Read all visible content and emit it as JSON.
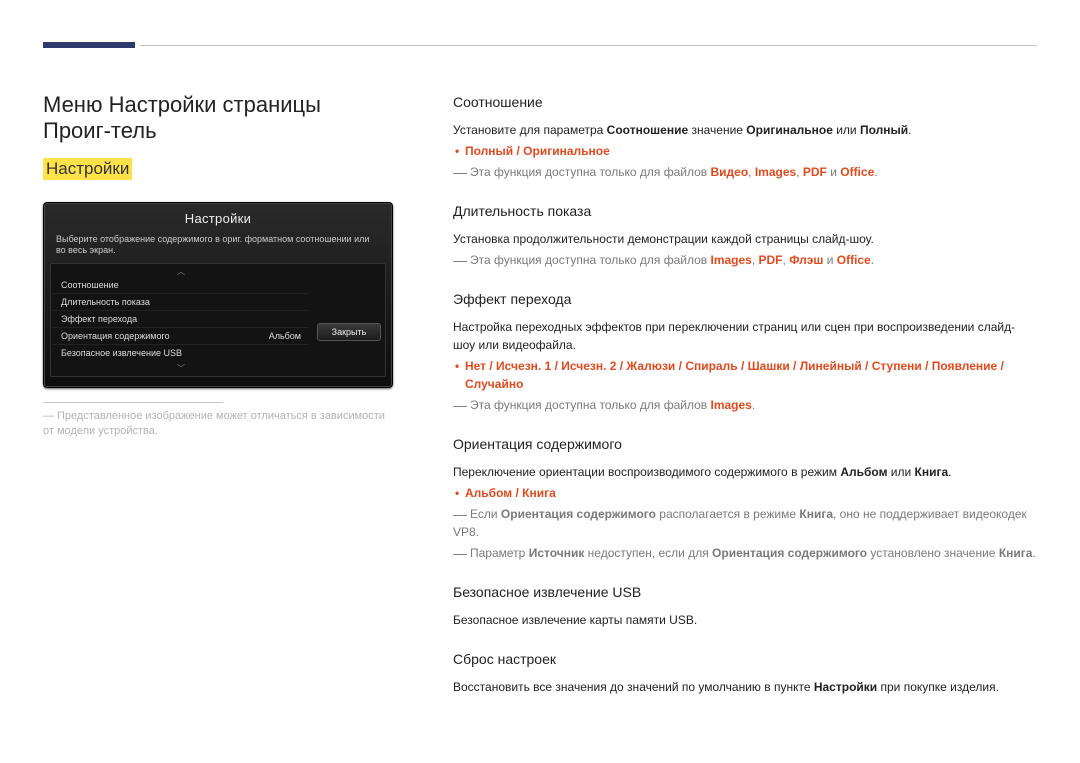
{
  "page_title": "Меню Настройки страницы Проиг-тель",
  "sub_title": "Настройки",
  "osd": {
    "title": "Настройки",
    "desc": "Выберите отображение содержимого в ориг. форматном соотношении или во весь экран.",
    "items": [
      {
        "label": "Соотношение",
        "value": ""
      },
      {
        "label": "Длительность показа",
        "value": ""
      },
      {
        "label": "Эффект перехода",
        "value": ""
      },
      {
        "label": "Ориентация содержимого",
        "value": "Альбом"
      },
      {
        "label": "Безопасное извлечение USB",
        "value": ""
      }
    ],
    "close_button": "Закрыть"
  },
  "caption": "Представленное изображение может отличаться в зависимости от модели устройства.",
  "sections": {
    "ratio": {
      "title": "Соотношение",
      "desc1_a": "Установите для параметра ",
      "desc1_b": "Соотношение",
      "desc1_c": " значение ",
      "desc1_d": "Оригинальное",
      "desc1_e": " или ",
      "desc1_f": "Полный",
      "options": "Полный / Оригинальное",
      "note_a": "Эта функция доступна только для файлов ",
      "note_b": "Видео",
      "note_c": "Images",
      "note_d": "PDF",
      "note_e": " и ",
      "note_f": "Office"
    },
    "duration": {
      "title": "Длительность показа",
      "desc": "Установка продолжительности демонстрации каждой страницы слайд-шоу.",
      "note_a": "Эта функция доступна только для файлов ",
      "note_b": "Images",
      "note_c": "PDF",
      "note_d": "Флэш",
      "note_e": " и ",
      "note_f": "Office"
    },
    "transition": {
      "title": "Эффект перехода",
      "desc": "Настройка переходных эффектов при переключении страниц или сцен при воспроизведении слайд-шоу или видеофайла.",
      "options": "Нет / Исчезн. 1 / Исчезн. 2 / Жалюзи / Спираль / Шашки / Линейный / Ступени / Появление / Случайно",
      "note_a": "Эта функция доступна только для файлов ",
      "note_b": "Images"
    },
    "orientation": {
      "title": "Ориентация содержимого",
      "desc_a": "Переключение ориентации воспроизводимого содержимого в режим ",
      "desc_b": "Альбом",
      "desc_c": " или ",
      "desc_d": "Книга",
      "options": "Альбом / Книга",
      "note1_a": "Если ",
      "note1_b": "Ориентация содержимого",
      "note1_c": " располагается в режиме ",
      "note1_d": "Книга",
      "note1_e": ", оно не поддерживает видеокодек VP8.",
      "note2_a": "Параметр ",
      "note2_b": "Источник",
      "note2_c": " недоступен, если для ",
      "note2_d": "Ориентация содержимого",
      "note2_e": " установлено значение ",
      "note2_f": "Книга"
    },
    "usb": {
      "title": "Безопасное извлечение USB",
      "desc": "Безопасное извлечение карты памяти USB."
    },
    "reset": {
      "title": "Сброс настроек",
      "desc_a": "Восстановить все значения до значений по умолчанию в пункте ",
      "desc_b": "Настройки",
      "desc_c": " при покупке изделия."
    }
  }
}
